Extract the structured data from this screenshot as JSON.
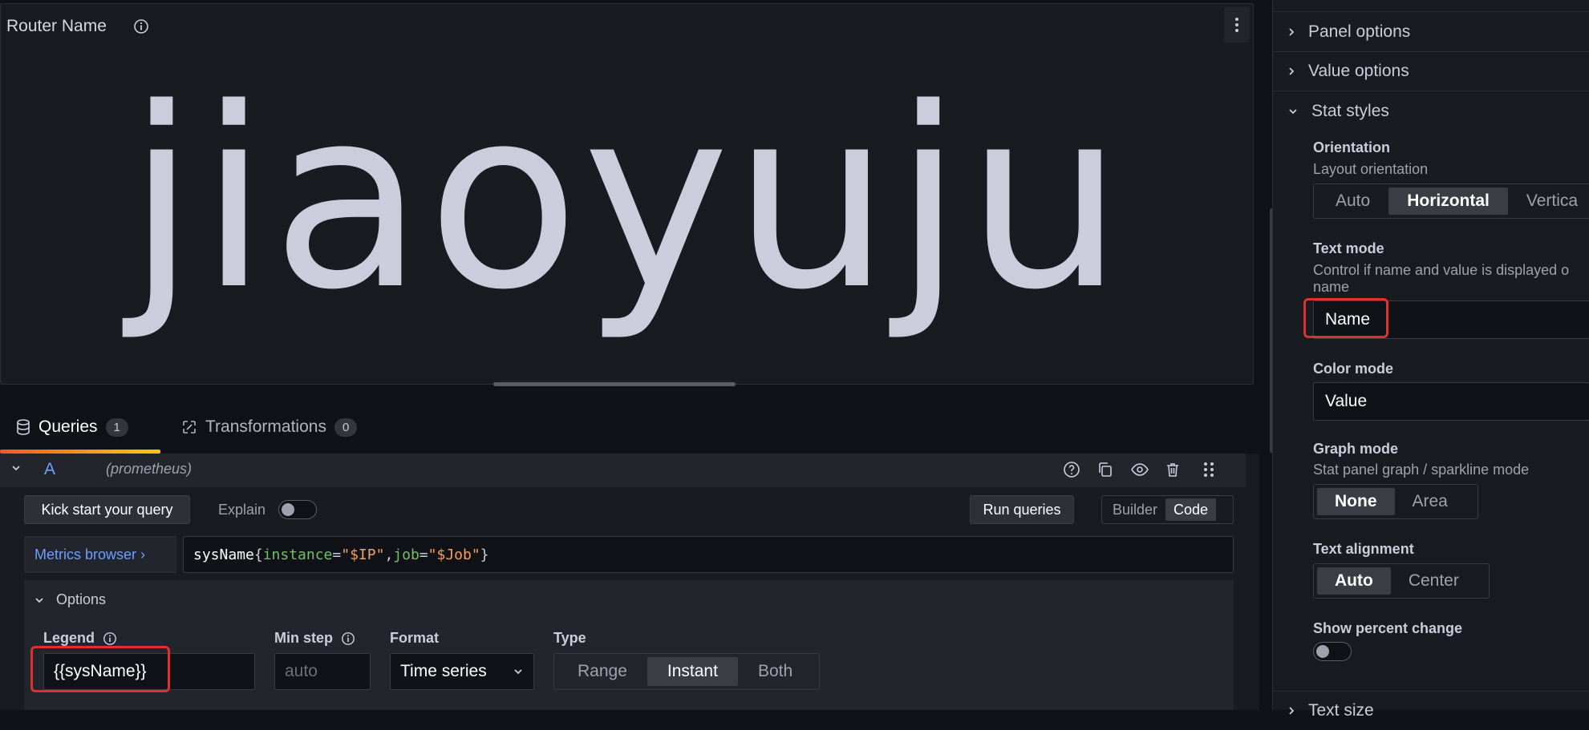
{
  "panel": {
    "title": "Router Name",
    "stat_value": "jiaoyuju"
  },
  "tabs": [
    {
      "label": "Queries",
      "count": "1"
    },
    {
      "label": "Transformations",
      "count": "0"
    }
  ],
  "query": {
    "ref": "A",
    "datasource": "(prometheus)",
    "kick_start_label": "Kick start your query",
    "explain_label": "Explain",
    "run_queries_label": "Run queries",
    "builder_label": "Builder",
    "code_label": "Code",
    "metrics_browser_label": "Metrics browser",
    "metrics_browser_chevron": "›",
    "expr": {
      "fn": "sysName",
      "open": "{",
      "label1": "instance",
      "eq1": "=",
      "val1": "\"$IP\"",
      "comma": ",",
      "label2": "job",
      "eq2": "=",
      "val2": "\"$Job\"",
      "close": "}"
    },
    "options": {
      "header": "Options",
      "legend_label": "Legend",
      "legend_value": "{{sysName}}",
      "min_step_label": "Min step",
      "min_step_placeholder": "auto",
      "format_label": "Format",
      "format_value": "Time series",
      "type_label": "Type",
      "type_options": [
        "Range",
        "Instant",
        "Both"
      ]
    }
  },
  "options_pane": {
    "panel_options": "Panel options",
    "value_options": "Value options",
    "stat_styles": "Stat styles",
    "orientation_label": "Orientation",
    "orientation_desc": "Layout orientation",
    "orientation_options": [
      "Auto",
      "Horizontal",
      "Vertica"
    ],
    "text_mode_label": "Text mode",
    "text_mode_desc": "Control if name and value is displayed o name",
    "text_mode_value": "Name",
    "color_mode_label": "Color mode",
    "color_mode_value": "Value",
    "graph_mode_label": "Graph mode",
    "graph_mode_desc": "Stat panel graph / sparkline mode",
    "graph_mode_options": [
      "None",
      "Area"
    ],
    "text_alignment_label": "Text alignment",
    "text_alignment_options": [
      "Auto",
      "Center"
    ],
    "show_percent_label": "Show percent change",
    "text_size": "Text size"
  },
  "colors": {
    "accent": "#6e9fff",
    "highlight": "#e02f2f",
    "background": "#111217",
    "panel": "#181b1f"
  }
}
